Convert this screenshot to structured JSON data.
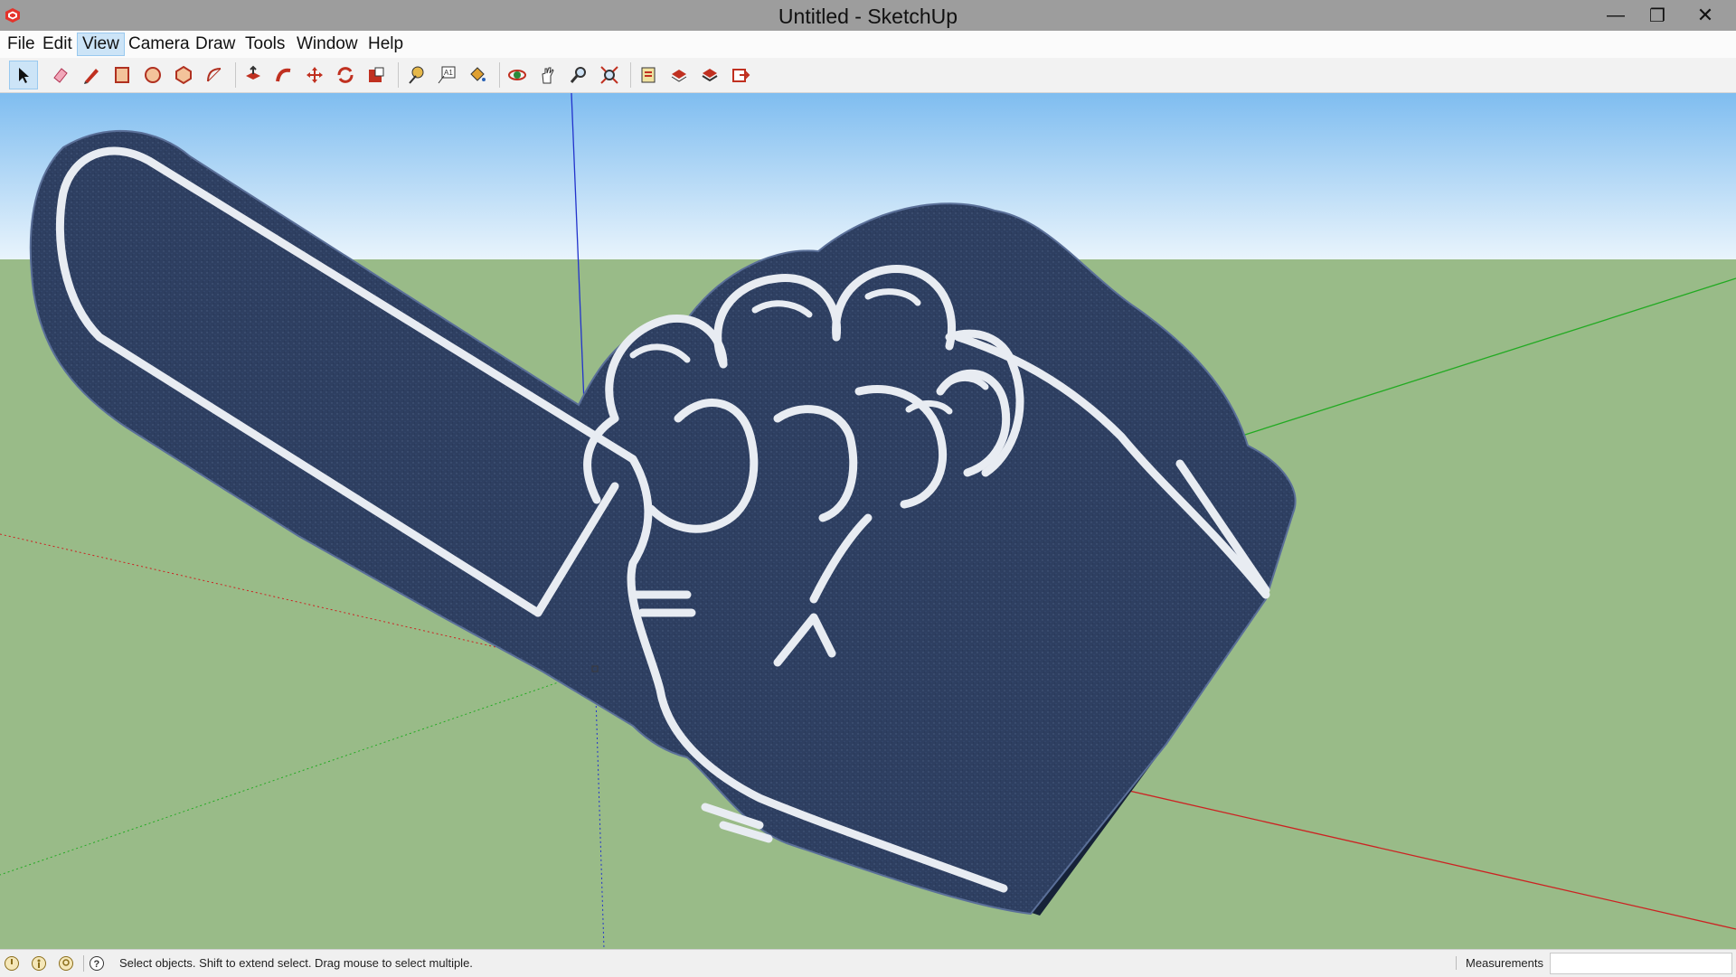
{
  "window": {
    "title": "Untitled - SketchUp"
  },
  "window_controls": {
    "minimize": "—",
    "restore": "❐",
    "close": "✕"
  },
  "menu": [
    {
      "label": "File"
    },
    {
      "label": "Edit"
    },
    {
      "label": "View",
      "active": true
    },
    {
      "label": "Camera"
    },
    {
      "label": "Draw"
    },
    {
      "label": "Tools"
    },
    {
      "label": "Window"
    },
    {
      "label": "Help"
    }
  ],
  "toolbar": {
    "tools": [
      "select-icon",
      "eraser-icon",
      "pencil-icon",
      "rectangle-icon",
      "circle-icon",
      "polygon-icon",
      "arc-icon",
      "push-pull-icon",
      "follow-me-icon",
      "move-icon",
      "rotate-icon",
      "scale-icon",
      "tape-measure-icon",
      "text-icon",
      "paint-bucket-icon",
      "orbit-icon",
      "pan-icon",
      "zoom-icon",
      "zoom-extents-icon",
      "3d-warehouse-icon",
      "extension-warehouse-icon",
      "layout-icon",
      "send-to-layout-icon"
    ]
  },
  "status": {
    "message": "Select objects. Shift to extend select. Drag mouse to select multiple.",
    "measurements_label": "Measurements",
    "measurements_value": ""
  },
  "colors": {
    "sky_top": "#7fbdf0",
    "sky_bottom": "#e9f4fc",
    "ground": "#99bb88",
    "foam_hand": "#2e3f61",
    "outline": "#e8ecf2",
    "axis_red": "#cc2222",
    "axis_green": "#22aa22",
    "axis_blue": "#2233cc"
  }
}
